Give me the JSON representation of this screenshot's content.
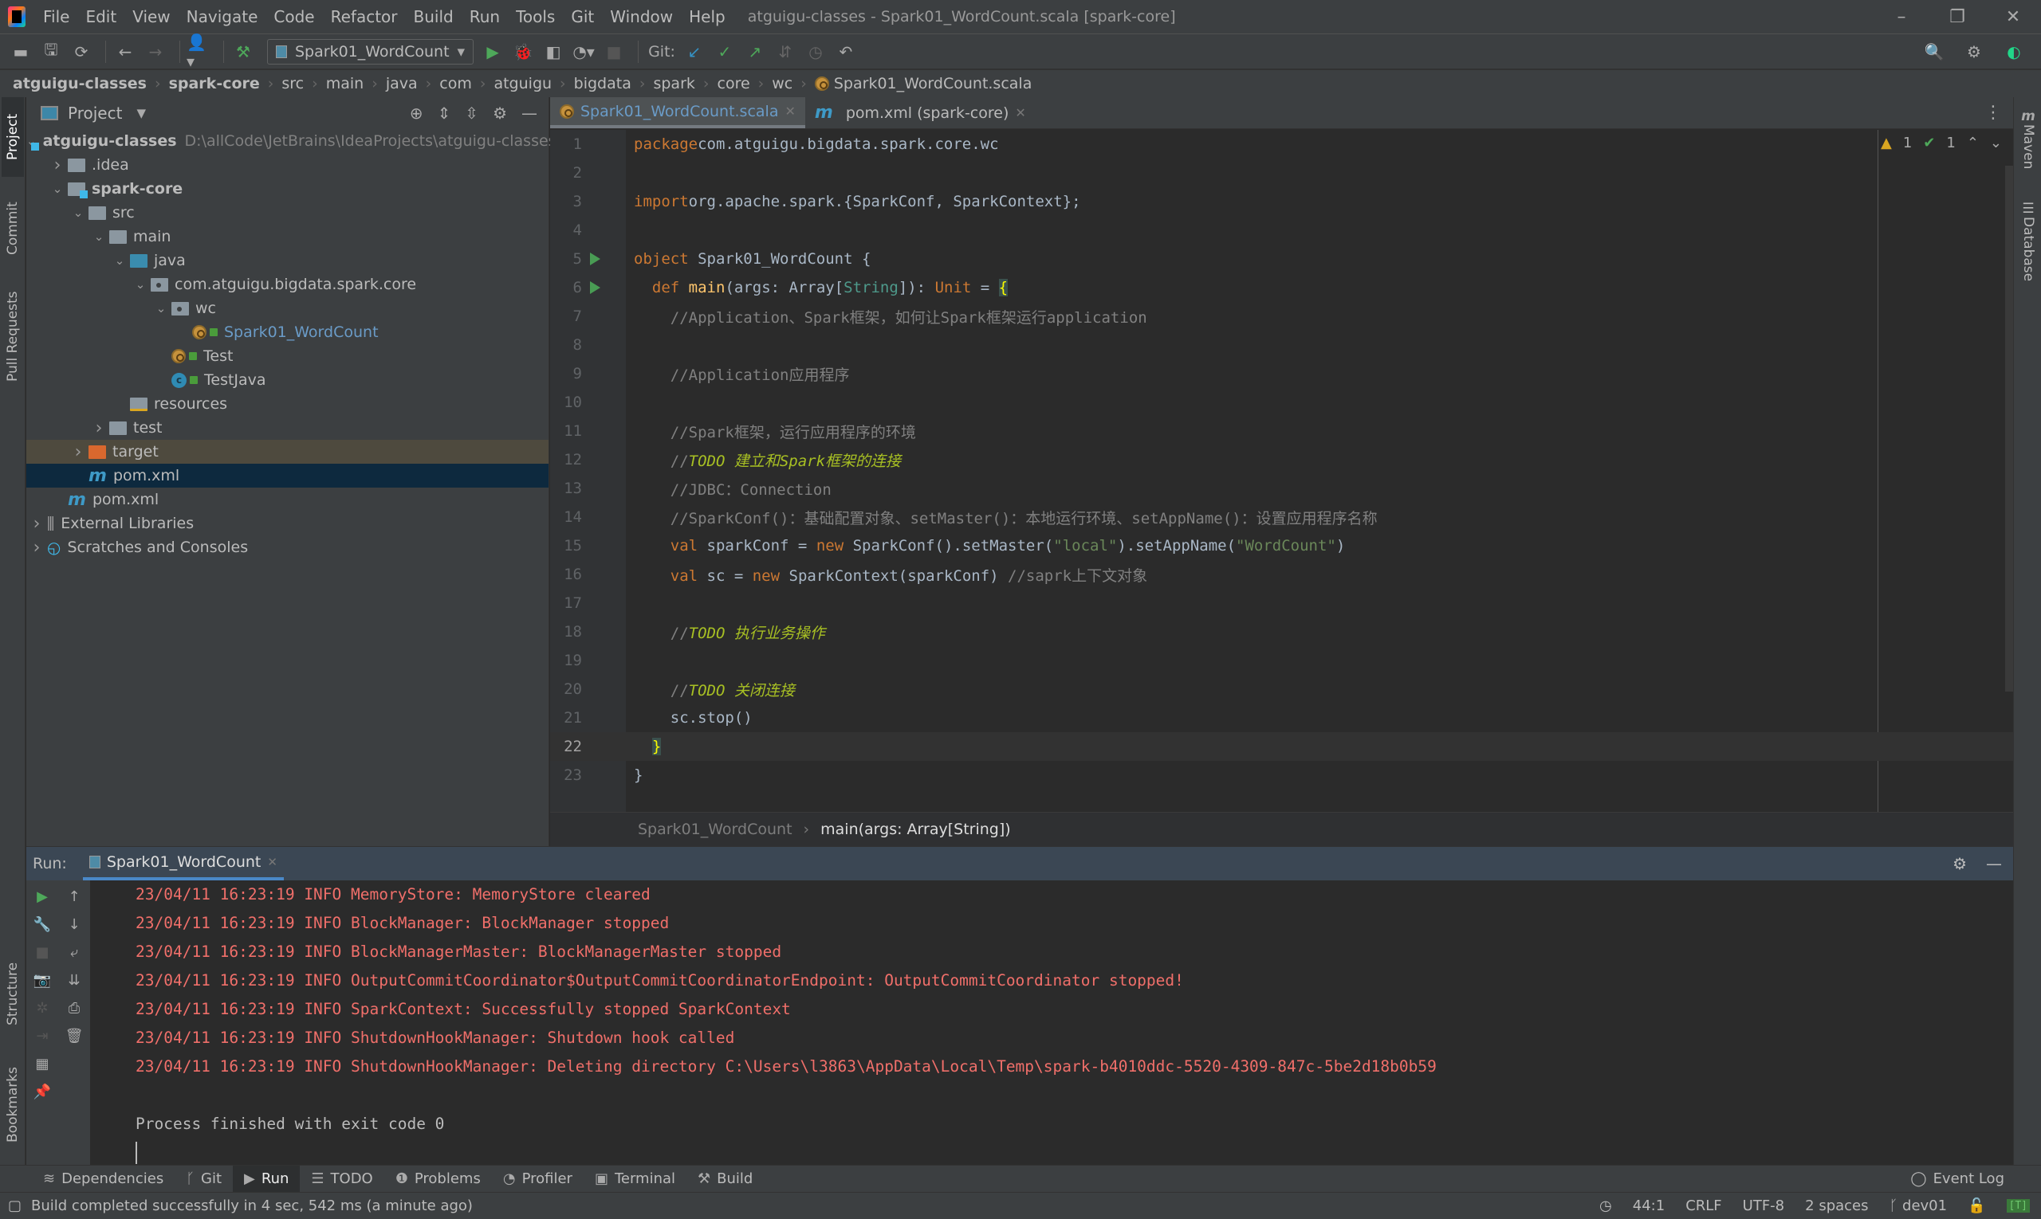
{
  "window": {
    "title": "atguigu-classes - Spark01_WordCount.scala [spark-core]",
    "controls": {
      "minimize": "–",
      "restore": "❐",
      "close": "✕"
    }
  },
  "menu": [
    "File",
    "Edit",
    "View",
    "Navigate",
    "Code",
    "Refactor",
    "Build",
    "Run",
    "Tools",
    "Git",
    "Window",
    "Help"
  ],
  "toolbar": {
    "run_config": "Spark01_WordCount",
    "git_label": "Git:",
    "icons": [
      "open-folder-icon",
      "save-icon",
      "sync-icon",
      "back-icon",
      "forward-icon",
      "user-icon",
      "build-hammer-icon",
      "run-icon",
      "debug-icon",
      "coverage-icon",
      "profile-icon",
      "stop-icon",
      "git-update-icon",
      "git-commit-icon",
      "git-push-icon",
      "git-compare-icon",
      "git-history-icon",
      "git-rollback-icon",
      "search-icon",
      "settings-icon",
      "toolbox-icon"
    ]
  },
  "breadcrumb": [
    "atguigu-classes",
    "spark-core",
    "src",
    "main",
    "java",
    "com",
    "atguigu",
    "bigdata",
    "spark",
    "core",
    "wc",
    "Spark01_WordCount.scala"
  ],
  "left_strip": {
    "project": "Project",
    "commit": "Commit",
    "pull_requests": "Pull Requests",
    "structure": "Structure",
    "bookmarks": "Bookmarks"
  },
  "project_panel": {
    "title": "Project",
    "tree": [
      {
        "label": "atguigu-classes",
        "path": "D:\\allCode\\JetBrains\\IdeaProjects\\atguigu-classes",
        "level": 0,
        "expanded": true,
        "icon": "module-folder"
      },
      {
        "label": ".idea",
        "level": 1,
        "expanded": false,
        "icon": "folder"
      },
      {
        "label": "spark-core",
        "level": 1,
        "expanded": true,
        "icon": "module-folder"
      },
      {
        "label": "src",
        "level": 2,
        "expanded": true,
        "icon": "folder"
      },
      {
        "label": "main",
        "level": 3,
        "expanded": true,
        "icon": "folder"
      },
      {
        "label": "java",
        "level": 4,
        "expanded": true,
        "icon": "source-folder"
      },
      {
        "label": "com.atguigu.bigdata.spark.core",
        "level": 5,
        "expanded": true,
        "icon": "package"
      },
      {
        "label": "wc",
        "level": 6,
        "expanded": true,
        "icon": "package"
      },
      {
        "label": "Spark01_WordCount",
        "level": 7,
        "icon": "scala-object"
      },
      {
        "label": "Test",
        "level": 6,
        "icon": "scala-object"
      },
      {
        "label": "TestJava",
        "level": 6,
        "icon": "java-class"
      },
      {
        "label": "resources",
        "level": 4,
        "icon": "resources-folder"
      },
      {
        "label": "test",
        "level": 3,
        "expanded": false,
        "icon": "folder"
      },
      {
        "label": "target",
        "level": 2,
        "expanded": false,
        "icon": "excluded-folder"
      },
      {
        "label": "pom.xml",
        "level": 2,
        "icon": "maven",
        "selected": true
      },
      {
        "label": "pom.xml",
        "level": 1,
        "icon": "maven"
      },
      {
        "label": "External Libraries",
        "level": 0,
        "expanded": false,
        "icon": "libraries"
      },
      {
        "label": "Scratches and Consoles",
        "level": 0,
        "expanded": false,
        "icon": "scratches"
      }
    ]
  },
  "editor": {
    "tabs": [
      {
        "label": "Spark01_WordCount.scala",
        "active": true
      },
      {
        "label": "pom.xml (spark-core)",
        "active": false
      }
    ],
    "inspections": {
      "warnings": "1",
      "weak_warnings": "1"
    },
    "current_line": 22,
    "lines": [
      {
        "n": "1",
        "tokens": [
          [
            "kw",
            "package"
          ],
          [
            "",
            "com.atguigu.bigdata.spark.core.wc"
          ]
        ]
      },
      {
        "n": "2",
        "tokens": []
      },
      {
        "n": "3",
        "tokens": [
          [
            "kw",
            "import"
          ],
          [
            "",
            "org.apache.spark.{SparkConf, SparkContext};"
          ]
        ]
      },
      {
        "n": "4",
        "tokens": []
      },
      {
        "n": "5",
        "tokens": [
          [
            "kw",
            "object"
          ],
          [
            "",
            " Spark01_WordCount {"
          ]
        ],
        "run": true
      },
      {
        "n": "6",
        "tokens": [
          [
            "",
            "  "
          ],
          [
            "kw",
            "def"
          ],
          [
            "",
            " "
          ],
          [
            "fn",
            "main"
          ],
          [
            "",
            "(args: Array["
          ],
          [
            "typ",
            "String"
          ],
          [
            "",
            "]): "
          ],
          [
            "kw",
            "Unit"
          ],
          [
            "",
            " = "
          ],
          [
            "brace",
            "{"
          ]
        ],
        "run": true
      },
      {
        "n": "7",
        "tokens": [
          [
            "",
            "    "
          ],
          [
            "cm",
            "//Application、Spark框架，如何让Spark框架运行application"
          ]
        ]
      },
      {
        "n": "8",
        "tokens": []
      },
      {
        "n": "9",
        "tokens": [
          [
            "",
            "    "
          ],
          [
            "cm",
            "//Application应用程序"
          ]
        ]
      },
      {
        "n": "10",
        "tokens": []
      },
      {
        "n": "11",
        "tokens": [
          [
            "",
            "    "
          ],
          [
            "cm",
            "//Spark框架，运行应用程序的环境"
          ]
        ]
      },
      {
        "n": "12",
        "tokens": [
          [
            "",
            "    "
          ],
          [
            "cm",
            "//"
          ],
          [
            "todo",
            "TODO 建立和Spark框架的连接"
          ]
        ]
      },
      {
        "n": "13",
        "tokens": [
          [
            "",
            "    "
          ],
          [
            "cm",
            "//JDBC：Connection"
          ]
        ]
      },
      {
        "n": "14",
        "tokens": [
          [
            "",
            "    "
          ],
          [
            "cm",
            "//SparkConf()：基础配置对象、setMaster()：本地运行环境、setAppName()：设置应用程序名称"
          ]
        ]
      },
      {
        "n": "15",
        "tokens": [
          [
            "",
            "    "
          ],
          [
            "kw",
            "val"
          ],
          [
            "",
            " sparkConf = "
          ],
          [
            "kw",
            "new"
          ],
          [
            "",
            " SparkConf().setMaster("
          ],
          [
            "str",
            "\"local\""
          ],
          [
            "",
            ").setAppName("
          ],
          [
            "str",
            "\"WordCount\""
          ],
          [
            "",
            ")"
          ]
        ]
      },
      {
        "n": "16",
        "tokens": [
          [
            "",
            "    "
          ],
          [
            "kw",
            "val"
          ],
          [
            "",
            " sc = "
          ],
          [
            "kw",
            "new"
          ],
          [
            "",
            " SparkContext(sparkConf) "
          ],
          [
            "cm",
            "//saprk上下文对象"
          ]
        ]
      },
      {
        "n": "17",
        "tokens": []
      },
      {
        "n": "18",
        "tokens": [
          [
            "",
            "    "
          ],
          [
            "cm",
            "//"
          ],
          [
            "todo",
            "TODO 执行业务操作"
          ]
        ]
      },
      {
        "n": "19",
        "tokens": []
      },
      {
        "n": "20",
        "tokens": [
          [
            "",
            "    "
          ],
          [
            "cm",
            "//"
          ],
          [
            "todo",
            "TODO 关闭连接"
          ]
        ]
      },
      {
        "n": "21",
        "tokens": [
          [
            "",
            "    sc.stop()"
          ]
        ]
      },
      {
        "n": "22",
        "tokens": [
          [
            "",
            "  "
          ],
          [
            "brace",
            "}"
          ]
        ]
      },
      {
        "n": "23",
        "tokens": [
          [
            "",
            "}"
          ]
        ]
      }
    ],
    "breadcrumb": [
      "Spark01_WordCount",
      "main(args: Array[String])"
    ]
  },
  "right_strip": {
    "maven": "Maven",
    "database": "Database"
  },
  "run_panel": {
    "label": "Run:",
    "tab": "Spark01_WordCount",
    "log": [
      "23/04/11 16:23:19 INFO MemoryStore: MemoryStore cleared",
      "23/04/11 16:23:19 INFO BlockManager: BlockManager stopped",
      "23/04/11 16:23:19 INFO BlockManagerMaster: BlockManagerMaster stopped",
      "23/04/11 16:23:19 INFO OutputCommitCoordinator$OutputCommitCoordinatorEndpoint: OutputCommitCoordinator stopped!",
      "23/04/11 16:23:19 INFO SparkContext: Successfully stopped SparkContext",
      "23/04/11 16:23:19 INFO ShutdownHookManager: Shutdown hook called",
      "23/04/11 16:23:19 INFO ShutdownHookManager: Deleting directory C:\\Users\\l3863\\AppData\\Local\\Temp\\spark-b4010ddc-5520-4309-847c-5be2d18b0b59"
    ],
    "exit_message": "Process finished with exit code 0"
  },
  "bottom_tabs": [
    {
      "label": "Dependencies",
      "icon": "≋"
    },
    {
      "label": "Git",
      "icon": "ᚴ"
    },
    {
      "label": "Run",
      "icon": "▶",
      "active": true
    },
    {
      "label": "TODO",
      "icon": "☰"
    },
    {
      "label": "Problems",
      "icon": "❶"
    },
    {
      "label": "Profiler",
      "icon": "◔"
    },
    {
      "label": "Terminal",
      "icon": "▣"
    },
    {
      "label": "Build",
      "icon": "⚒"
    }
  ],
  "event_log": "Event Log",
  "status": {
    "message": "Build completed successfully in 4 sec, 542 ms (a minute ago)",
    "position": "44:1",
    "line_sep": "CRLF",
    "encoding": "UTF-8",
    "indent": "2 spaces",
    "branch": "dev01",
    "badge": "[T]"
  }
}
